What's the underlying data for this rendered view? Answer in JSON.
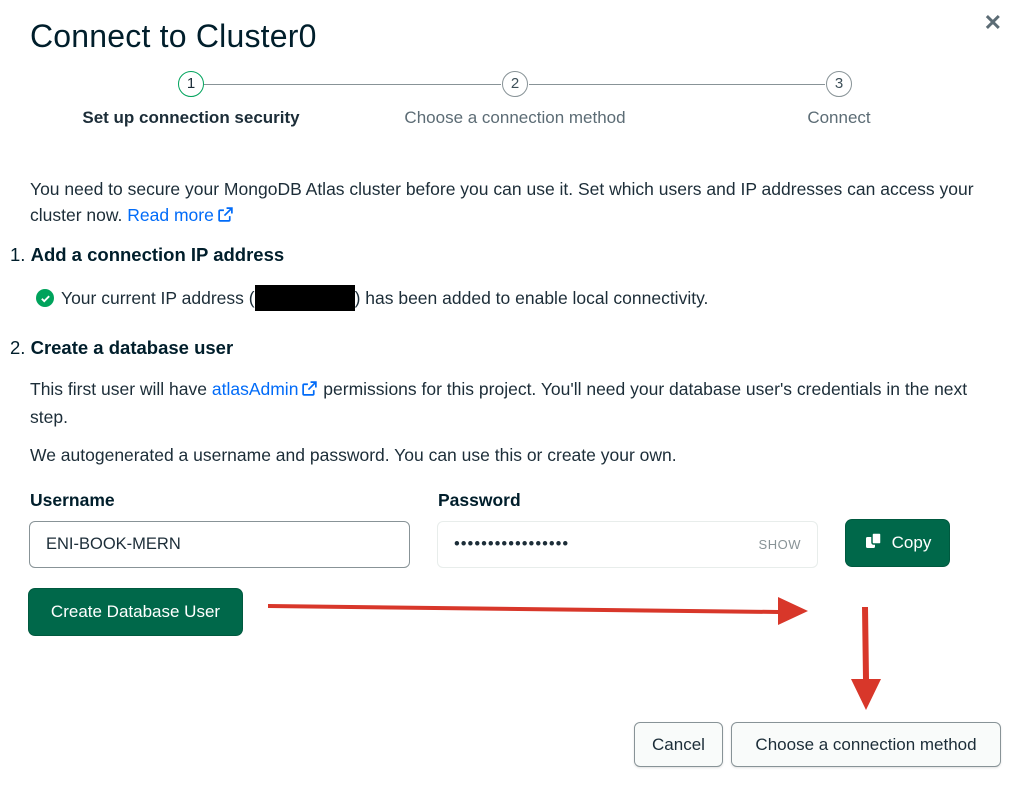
{
  "modal": {
    "title": "Connect to Cluster0",
    "close_icon": "close-icon"
  },
  "stepper": {
    "steps": [
      {
        "number": "1",
        "label": "Set up connection security",
        "active": true
      },
      {
        "number": "2",
        "label": "Choose a connection method",
        "active": false
      },
      {
        "number": "3",
        "label": "Connect",
        "active": false
      }
    ]
  },
  "intro": {
    "text": "You need to secure your MongoDB Atlas cluster before you can use it. Set which users and IP addresses can access your cluster now. ",
    "link": "Read more"
  },
  "section1": {
    "number": "1.",
    "heading": "Add a connection IP address",
    "ip_before": "Your current IP address (",
    "ip_after": ") has been added to enable local connectivity."
  },
  "section2": {
    "number": "2.",
    "heading": "Create a database user",
    "perm_before": "This first user will have ",
    "perm_link": "atlasAdmin",
    "perm_after": " permissions for this project. You'll need your database user's credentials in the next step.",
    "autogen": "We autogenerated a username and password. You can use this or create your own."
  },
  "form": {
    "username_label": "Username",
    "username_value": "ENI-BOOK-MERN",
    "password_label": "Password",
    "password_value": "•••••••••••••••••",
    "show_label": "SHOW",
    "copy_label": "Copy",
    "create_user_label": "Create Database User"
  },
  "footer": {
    "cancel_label": "Cancel",
    "next_label": "Choose a connection method"
  },
  "colors": {
    "primary_green": "#00684a",
    "success_green": "#00a35c",
    "link_blue": "#016bf8",
    "annotation_red": "#d8372a"
  }
}
